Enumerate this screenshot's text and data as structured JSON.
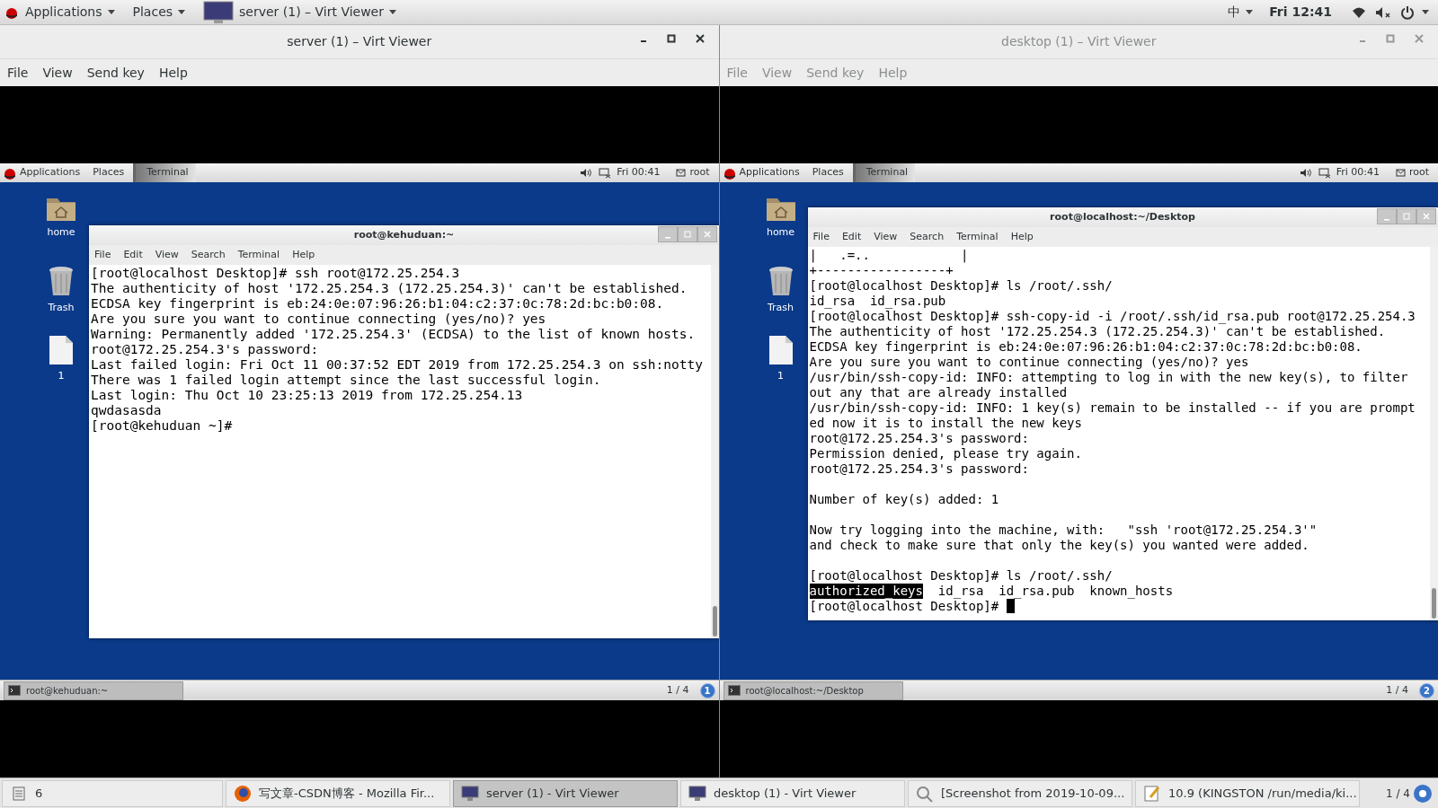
{
  "top_bar": {
    "applications": "Applications",
    "places": "Places",
    "window_menu": "server (1) – Virt Viewer",
    "input_method": "中",
    "clock": "Fri 12:41"
  },
  "viewers": [
    {
      "title": "server (1) – Virt Viewer",
      "active": true,
      "menu": [
        "File",
        "View",
        "Send key",
        "Help"
      ],
      "guest": {
        "panel": {
          "applications": "Applications",
          "places": "Places",
          "task": "Terminal",
          "clock": "Fri 00:41",
          "user": "root"
        },
        "desktop_icons": [
          {
            "label": "home",
            "kind": "folder"
          },
          {
            "label": "Trash",
            "kind": "trash"
          },
          {
            "label": "1",
            "kind": "file"
          }
        ],
        "terminal": {
          "title": "root@kehuduan:~",
          "menu": [
            "File",
            "Edit",
            "View",
            "Search",
            "Terminal",
            "Help"
          ],
          "cursor": false,
          "blocks": [
            [
              "[root@localhost Desktop]# ssh root@172.25.254.3",
              "The authenticity of host '172.25.254.3 (172.25.254.3)' can't be established.",
              "ECDSA key fingerprint is eb:24:0e:07:96:26:b1:04:c2:37:0c:78:2d:bc:b0:08.",
              "Are you sure you want to continue connecting (yes/no)? yes",
              "Warning: Permanently added '172.25.254.3' (ECDSA) to the list of known hosts.",
              "root@172.25.254.3's password:",
              "Last failed login: Fri Oct 11 00:37:52 EDT 2019 from 172.25.254.3 on ssh:notty",
              "There was 1 failed login attempt since the last successful login.",
              "Last login: Thu Oct 10 23:25:13 2019 from 172.25.254.13",
              "qwdasasda",
              "[root@kehuduan ~]#"
            ]
          ]
        },
        "bottom_panel": {
          "task": "root@kehuduan:~",
          "pager": "1 / 4",
          "workspace": "1"
        }
      }
    },
    {
      "title": "desktop (1) – Virt Viewer",
      "active": false,
      "menu": [
        "File",
        "View",
        "Send key",
        "Help"
      ],
      "guest": {
        "panel": {
          "applications": "Applications",
          "places": "Places",
          "task": "Terminal",
          "clock": "Fri 00:41",
          "user": "root"
        },
        "desktop_icons": [
          {
            "label": "home",
            "kind": "folder"
          },
          {
            "label": "Trash",
            "kind": "trash"
          },
          {
            "label": "1",
            "kind": "file"
          }
        ],
        "terminal": {
          "title": "root@localhost:~/Desktop",
          "menu": [
            "File",
            "Edit",
            "View",
            "Search",
            "Terminal",
            "Help"
          ],
          "cursor": true,
          "blocks": [
            [
              "|   .=..            |",
              "+-----------------+",
              "[root@localhost Desktop]# ls /root/.ssh/",
              "id_rsa  id_rsa.pub",
              "[root@localhost Desktop]# ssh-copy-id -i /root/.ssh/id_rsa.pub root@172.25.254.3",
              "The authenticity of host '172.25.254.3 (172.25.254.3)' can't be established.",
              "ECDSA key fingerprint is eb:24:0e:07:96:26:b1:04:c2:37:0c:78:2d:bc:b0:08.",
              "Are you sure you want to continue connecting (yes/no)? yes",
              "/usr/bin/ssh-copy-id: INFO: attempting to log in with the new key(s), to filter",
              "out any that are already installed",
              "/usr/bin/ssh-copy-id: INFO: 1 key(s) remain to be installed -- if you are prompt",
              "ed now it is to install the new keys",
              "root@172.25.254.3's password:",
              "Permission denied, please try again.",
              "root@172.25.254.3's password:"
            ],
            [
              "Number of key(s) added: 1"
            ],
            [
              "Now try logging into the machine, with:   \"ssh 'root@172.25.254.3'\"",
              "and check to make sure that only the key(s) you wanted were added."
            ],
            [
              "[root@localhost Desktop]# ls /root/.ssh/",
              {
                "parts": [
                  {
                    "text": "authorized_keys",
                    "highlighted": true
                  },
                  {
                    "text": "  id_rsa  id_rsa.pub  known_hosts",
                    "highlighted": false
                  }
                ]
              },
              "[root@localhost Desktop]# "
            ]
          ]
        },
        "bottom_panel": {
          "task": "root@localhost:~/Desktop",
          "pager": "1 / 4",
          "workspace": "2"
        }
      }
    }
  ],
  "taskbar": {
    "workspace": "6",
    "items": [
      {
        "label": "写文章-CSDN博客 - Mozilla Fir...",
        "kind": "browser",
        "selected": false
      },
      {
        "label": "server (1) - Virt Viewer",
        "kind": "viewer",
        "selected": true
      },
      {
        "label": "desktop (1) - Virt Viewer",
        "kind": "viewer",
        "selected": false
      },
      {
        "label": "[Screenshot from 2019-10-09...",
        "kind": "image",
        "selected": false
      },
      {
        "label": "10.9 (KINGSTON /run/media/ki...",
        "kind": "editor",
        "selected": false
      }
    ],
    "pager": "1 / 4"
  }
}
